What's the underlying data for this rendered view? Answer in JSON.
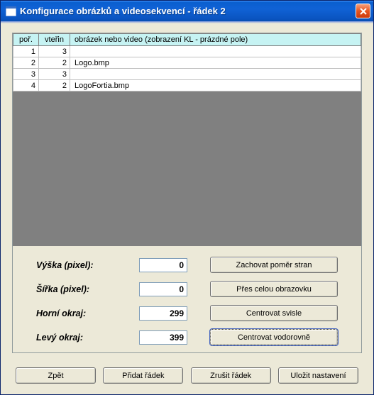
{
  "window": {
    "title": "Konfigurace obrázků a videosekvencí - řádek 2"
  },
  "grid": {
    "headers": {
      "por": "poř.",
      "sec": "vteřin",
      "file": "obrázek nebo video (zobrazení KL - prázdné pole)"
    },
    "rows": [
      {
        "por": "1",
        "sec": "3",
        "file": ""
      },
      {
        "por": "2",
        "sec": "2",
        "file": "Logo.bmp"
      },
      {
        "por": "3",
        "sec": "3",
        "file": ""
      },
      {
        "por": "4",
        "sec": "2",
        "file": "LogoFortia.bmp"
      }
    ]
  },
  "fields": {
    "height_label": "Výška (pixel):",
    "height_value": "0",
    "width_label": "Šířka (pixel):",
    "width_value": "0",
    "top_label": "Horní okraj:",
    "top_value": "299",
    "left_label": "Levý okraj:",
    "left_value": "399"
  },
  "side_buttons": {
    "keep_ratio": "Zachovat poměr stran",
    "fullscreen": "Přes celou obrazovku",
    "center_v": "Centrovat svisle",
    "center_h": "Centrovat vodorovně"
  },
  "bottom_buttons": {
    "back": "Zpět",
    "add": "Přidat řádek",
    "del": "Zrušit řádek",
    "save": "Uložit nastavení"
  }
}
